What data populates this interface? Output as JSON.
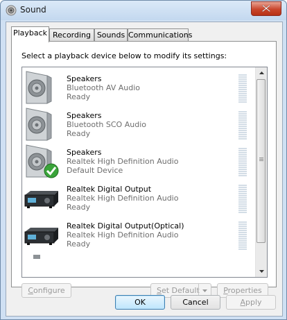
{
  "window": {
    "title": "Sound"
  },
  "tabs": [
    {
      "label": "Playback",
      "active": true
    },
    {
      "label": "Recording",
      "active": false
    },
    {
      "label": "Sounds",
      "active": false
    },
    {
      "label": "Communications",
      "active": false
    }
  ],
  "instruction": "Select a playback device below to modify its settings:",
  "devices": [
    {
      "name": "Speakers",
      "description": "Bluetooth AV Audio",
      "status": "Ready",
      "icon": "speaker-icon",
      "default": false
    },
    {
      "name": "Speakers",
      "description": "Bluetooth SCO Audio",
      "status": "Ready",
      "icon": "speaker-icon",
      "default": false
    },
    {
      "name": "Speakers",
      "description": "Realtek High Definition Audio",
      "status": "Default Device",
      "icon": "speaker-icon",
      "default": true
    },
    {
      "name": "Realtek Digital Output",
      "description": "Realtek High Definition Audio",
      "status": "Ready",
      "icon": "receiver-icon",
      "default": false
    },
    {
      "name": "Realtek Digital Output(Optical)",
      "description": "Realtek High Definition Audio",
      "status": "Ready",
      "icon": "receiver-icon",
      "default": false
    }
  ],
  "buttons": {
    "configure_pre": "",
    "configure_u": "C",
    "configure_post": "onfigure",
    "set_default_pre": "",
    "set_default_u": "S",
    "set_default_post": "et Default",
    "properties_pre": "",
    "properties_u": "P",
    "properties_post": "roperties",
    "ok": "OK",
    "cancel": "Cancel",
    "apply_pre": "",
    "apply_u": "A",
    "apply_post": "pply"
  },
  "colors": {
    "titlebar": "#c3d8ef",
    "close_button": "#c9462c",
    "default_check": "#3aa43a",
    "meter": "#d3dde6"
  }
}
